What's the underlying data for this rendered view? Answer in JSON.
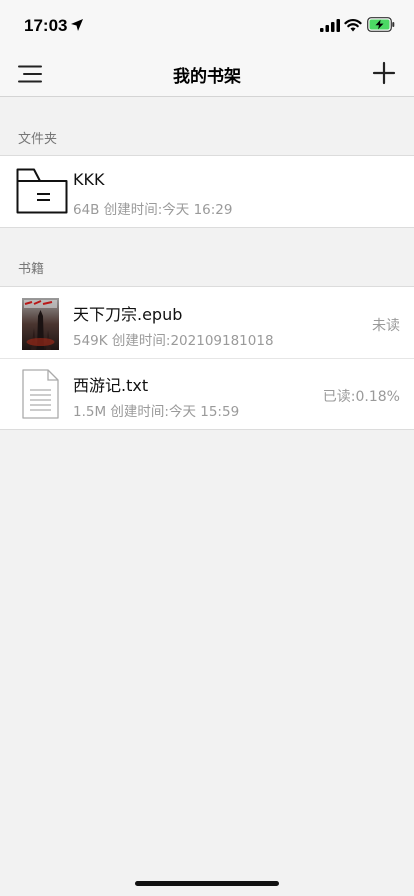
{
  "status_bar": {
    "time": "17:03",
    "icons": [
      "location-arrow-icon",
      "signal-icon",
      "wifi-icon",
      "battery-charging-icon"
    ],
    "battery_color": "#4cd964"
  },
  "nav": {
    "title": "我的书架",
    "left_icon": "menu-icon",
    "right_icon": "plus-icon"
  },
  "folders": {
    "header": "文件夹",
    "items": [
      {
        "name": "KKK",
        "info": "64B 创建时间:今天 16:29",
        "icon": "folder-icon"
      }
    ]
  },
  "books": {
    "header": "书籍",
    "items": [
      {
        "name": "天下刀宗.epub",
        "info": "549K 创建时间:202109181018",
        "status": "未读",
        "icon": "book-cover"
      },
      {
        "name": "西游记.txt",
        "info": "1.5M 创建时间:今天 15:59",
        "status": "已读:0.18%",
        "icon": "text-file-icon"
      }
    ]
  }
}
